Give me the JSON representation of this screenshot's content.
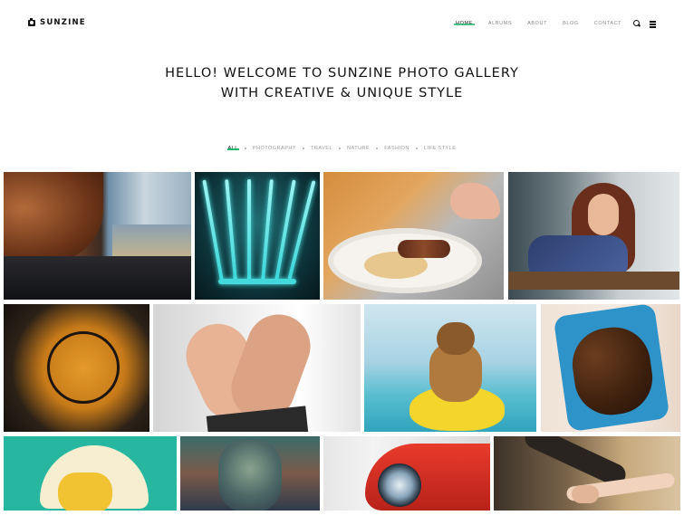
{
  "header": {
    "logo_text": "SUNZINE",
    "nav": [
      {
        "label": "HOME",
        "active": true
      },
      {
        "label": "ALBUMS",
        "active": false
      },
      {
        "label": "ABOUT",
        "active": false
      },
      {
        "label": "BLOG",
        "active": false
      },
      {
        "label": "CONTACT",
        "active": false
      }
    ],
    "icons": [
      "search-icon",
      "menu-icon"
    ]
  },
  "hero": {
    "line1": "HELLO! WELCOME TO SUNZINE PHOTO GALLERY",
    "line2": "WITH CREATIVE & UNIQUE STYLE"
  },
  "filters": [
    {
      "label": "ALL",
      "active": true
    },
    {
      "label": "PHOTOGRAPHY",
      "active": false
    },
    {
      "label": "TRAVEL",
      "active": false
    },
    {
      "label": "NATURE",
      "active": false
    },
    {
      "label": "FASHION",
      "active": false
    },
    {
      "label": "LIFE STYLE",
      "active": false
    }
  ],
  "colors": {
    "accent": "#1db870",
    "text": "#111111",
    "muted": "#888888",
    "background": "#ffffff"
  }
}
